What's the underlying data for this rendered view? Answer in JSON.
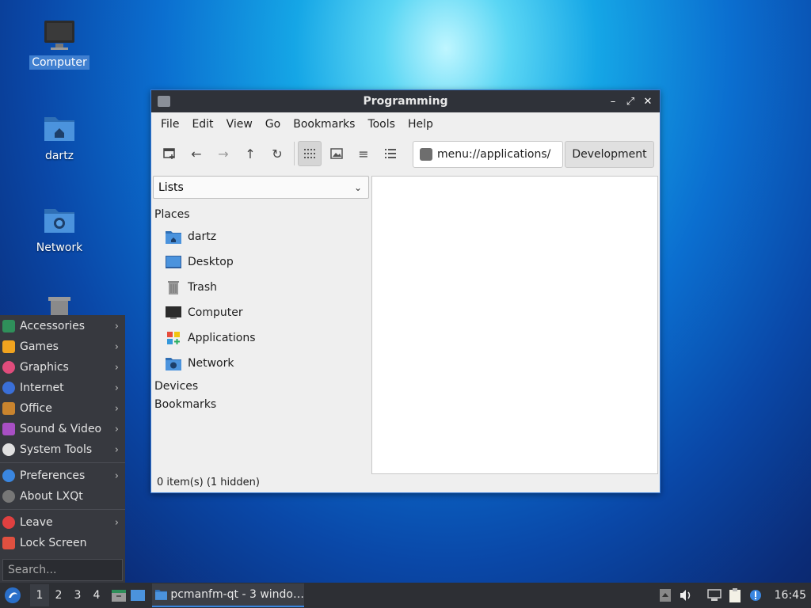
{
  "desktop": {
    "icons": [
      {
        "label": "Computer"
      },
      {
        "label": "dartz"
      },
      {
        "label": "Network"
      }
    ]
  },
  "window": {
    "title": "Programming",
    "menu": [
      "File",
      "Edit",
      "View",
      "Go",
      "Bookmarks",
      "Tools",
      "Help"
    ],
    "path": "menu://applications/",
    "path_button": "Development",
    "side_combo": "Lists",
    "places_header": "Places",
    "places": [
      {
        "label": "dartz",
        "icon": "home-folder-icon"
      },
      {
        "label": "Desktop",
        "icon": "desktop-icon"
      },
      {
        "label": "Trash",
        "icon": "trash-icon"
      },
      {
        "label": "Computer",
        "icon": "computer-icon"
      },
      {
        "label": "Applications",
        "icon": "applications-icon"
      },
      {
        "label": "Network",
        "icon": "network-folder-icon"
      }
    ],
    "devices_header": "Devices",
    "bookmarks_header": "Bookmarks",
    "status": "0 item(s) (1 hidden)"
  },
  "start_menu": {
    "categories": [
      {
        "label": "Accessories",
        "color": "#2f8f5a"
      },
      {
        "label": "Games",
        "color": "#f0a31f"
      },
      {
        "label": "Graphics",
        "color": "#e04c7c"
      },
      {
        "label": "Internet",
        "color": "#3a6fd8"
      },
      {
        "label": "Office",
        "color": "#c9842e"
      },
      {
        "label": "Sound & Video",
        "color": "#a84fc4"
      },
      {
        "label": "System Tools",
        "color": "#e0e0e0"
      }
    ],
    "preferences": "Preferences",
    "about": "About LXQt",
    "leave": "Leave",
    "lock": "Lock Screen",
    "search_placeholder": "Search..."
  },
  "panel": {
    "workspaces": [
      "1",
      "2",
      "3",
      "4"
    ],
    "task": "pcmanfm-qt - 3 windo…",
    "clock": "16:45"
  },
  "colors": {
    "accent": "#3a86e0",
    "panel_bg": "#2d2f34",
    "menu_bg": "#37393f"
  }
}
